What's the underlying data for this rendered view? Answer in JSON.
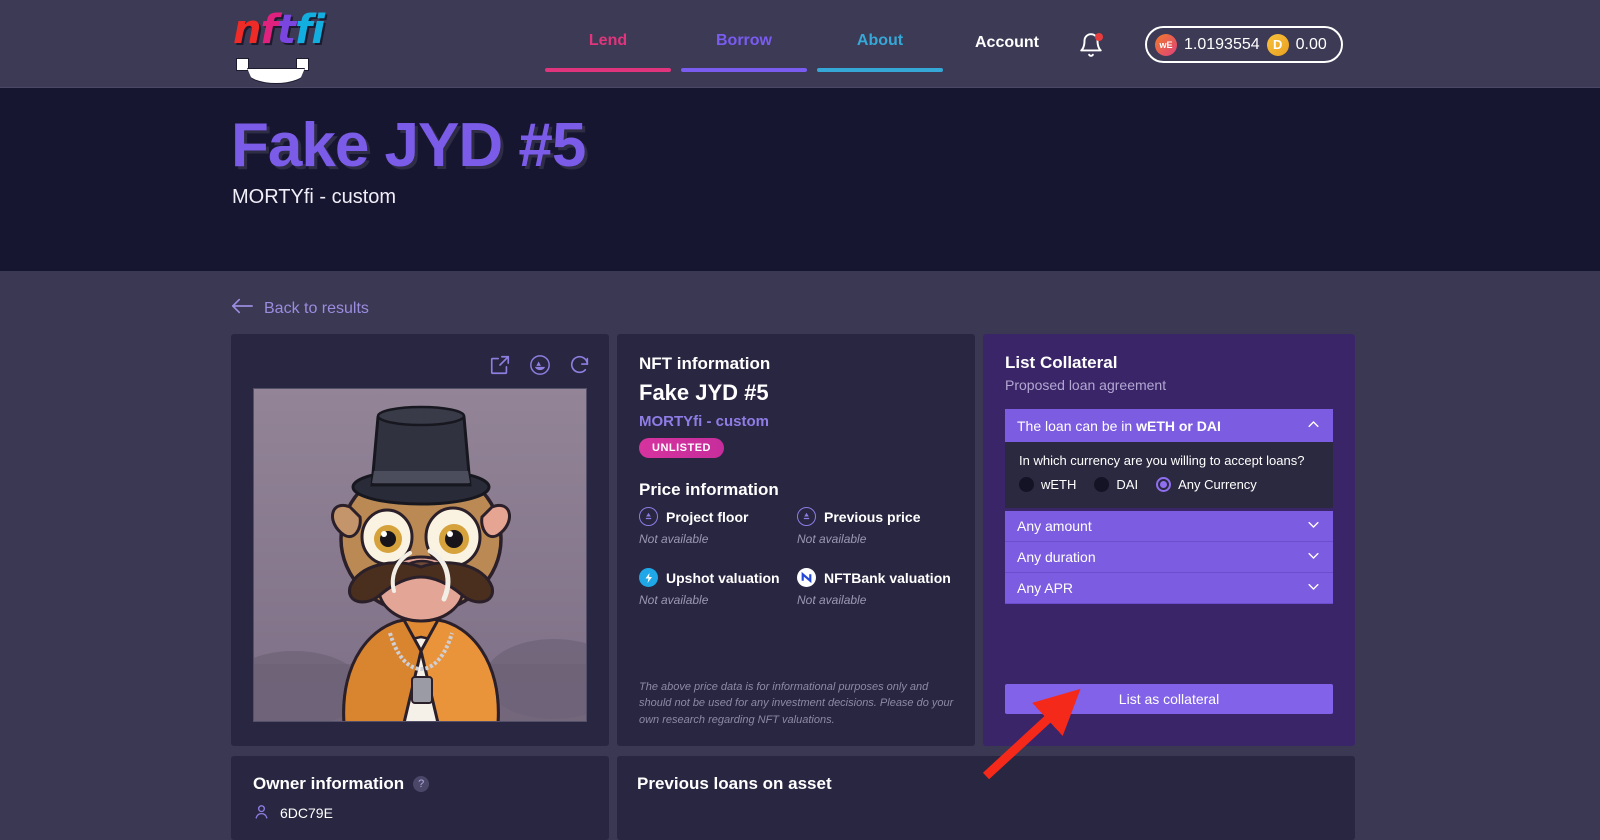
{
  "header": {
    "logo_letters": [
      "n",
      "f",
      "t",
      "fi"
    ],
    "nav": [
      {
        "label": "Lend",
        "color": "#e0357c"
      },
      {
        "label": "Borrow",
        "color": "#7a5cf0"
      },
      {
        "label": "About",
        "color": "#35a8d8"
      }
    ],
    "account_label": "Account",
    "bell_icon": "bell-icon",
    "wallet": {
      "weth_icon_label": "wE",
      "weth_balance": "1.0193554",
      "dai_icon_label": "D",
      "dai_balance": "0.00"
    }
  },
  "hero": {
    "title": "Fake JYD #5",
    "subtitle": "MORTYfi - custom"
  },
  "back_link": {
    "label": "Back to results",
    "icon": "arrow-left-icon"
  },
  "nft_image_card": {
    "actions": [
      {
        "icon": "external-link-icon"
      },
      {
        "icon": "opensea-icon"
      },
      {
        "icon": "refresh-icon"
      }
    ]
  },
  "nft_info": {
    "section_title": "NFT information",
    "name": "Fake JYD #5",
    "collection": "MORTYfi - custom",
    "status_badge": "UNLISTED",
    "price_section_title": "Price information",
    "price_items": [
      {
        "label": "Project floor",
        "value": "Not available",
        "icon": "project-floor-icon"
      },
      {
        "label": "Previous price",
        "value": "Not available",
        "icon": "previous-price-icon"
      },
      {
        "label": "Upshot valuation",
        "value": "Not available",
        "icon": "upshot-icon"
      },
      {
        "label": "NFTBank valuation",
        "value": "Not available",
        "icon": "nftbank-icon"
      }
    ],
    "disclaimer": "The above price data is for informational purposes only and should not be used for any investment decisions. Please do your own research regarding NFT valuations."
  },
  "collateral": {
    "title": "List Collateral",
    "subtitle": "Proposed loan agreement",
    "currency_accordion": {
      "prefix": "The loan can be in ",
      "emphasis": "wETH or DAI",
      "chevron": "chevron-up-icon",
      "question": "In which currency are you willing to accept loans?",
      "options": [
        {
          "label": "wETH",
          "selected": false
        },
        {
          "label": "DAI",
          "selected": false
        },
        {
          "label": "Any Currency",
          "selected": true
        }
      ]
    },
    "rows": [
      {
        "label": "Any amount",
        "chevron": "chevron-down-icon"
      },
      {
        "label": "Any duration",
        "chevron": "chevron-down-icon"
      },
      {
        "label": "Any APR",
        "chevron": "chevron-down-icon"
      }
    ],
    "submit_label": "List as collateral"
  },
  "owner": {
    "title": "Owner information",
    "help_icon_label": "?",
    "address": "6DC79E"
  },
  "previous_loans": {
    "title": "Previous loans on asset"
  },
  "annotation": {
    "arrow_color": "#f4291a"
  },
  "colors": {
    "header_bg": "#3c3a55",
    "hero_bg": "#171630",
    "page_bg": "#3a3852",
    "card_bg": "#282640",
    "collateral_bg": "#3a2569",
    "accent_purple": "#7c5ce0",
    "accent_pink": "#e0357c"
  }
}
